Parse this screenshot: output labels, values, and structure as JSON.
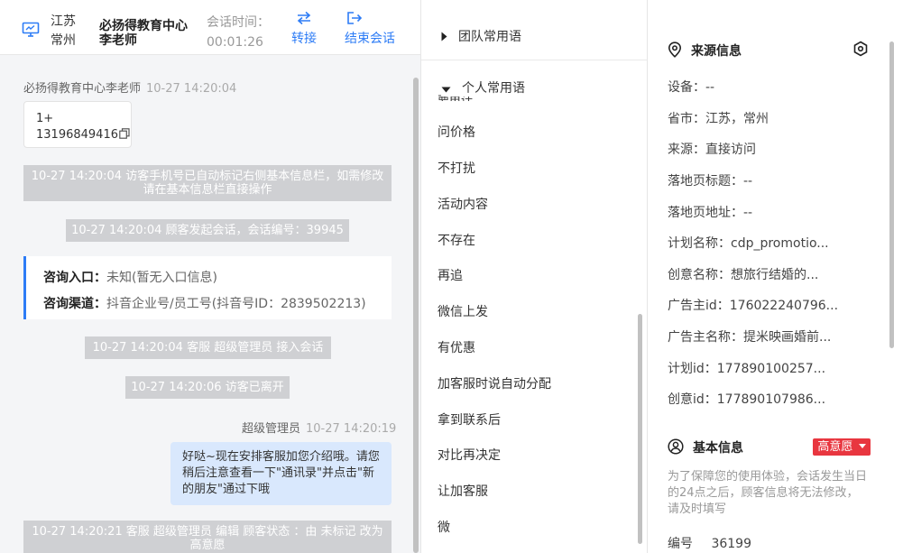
{
  "header": {
    "region_province": "江苏",
    "region_city": "常州",
    "agent_name": "必扬得教育中心李老师",
    "timer_label": "会话时间：",
    "timer_value": "00:01:26",
    "transfer_label": "转接",
    "end_label": "结束会话"
  },
  "chat": {
    "msg1_sender": "必扬得教育中心李老师",
    "msg1_time": "10-27 14:20:04",
    "phone_line1": "1+",
    "phone_line2": "13196849416",
    "sys1": "10-27 14:20:04 访客手机号已自动标记右侧基本信息栏，如需修改请在基本信息栏直接操作",
    "sys2": "10-27 14:20:04 顾客发起会话，会话编号：39945",
    "entry_label": "咨询入口：",
    "entry_value": "未知(暂无入口信息)",
    "channel_label": "咨询渠道：",
    "channel_value": "抖音企业号/员工号(抖音号ID：2839502213)",
    "sys3": "10-27 14:20:04 客服 超级管理员 接入会话",
    "sys4": "10-27 14:20:06 访客已离开",
    "msg2_sender": "超级管理员",
    "msg2_time": "10-27 14:20:19",
    "msg2_text": "好哒~现在安排客服加您介绍哦。请您稍后注意查看一下\"通讯录\"并点击\"新的朋友\"通过下哦",
    "sys5": "10-27 14:20:21 客服 超级管理员 编辑 顾客状态 ：由 未标记 改为 高意愿"
  },
  "phrases": {
    "team_label": "团队常用语",
    "personal_label": "个人常用语",
    "partial_item": "要电话",
    "items": [
      "问价格",
      "不打扰",
      "活动内容",
      "不存在",
      "再追",
      "微信上发",
      "有优惠",
      "加客服时说自动分配",
      "拿到联系后",
      "对比再决定",
      "让加客服",
      "微"
    ]
  },
  "source": {
    "title": "来源信息",
    "fields": [
      "设备：--",
      "省市：江苏，常州",
      "来源：直接访问",
      "落地页标题：--",
      "落地页地址：--",
      "计划名称：cdp_promotio...",
      "创意名称：想旅行结婚的...",
      "广告主id：176022240796...",
      "广告主名称：提米映画婚前...",
      "计划id：177890100257...",
      "创意id：177890107986..."
    ]
  },
  "basic": {
    "title": "基本信息",
    "intent_badge": "高意愿",
    "notice": "为了保障您的使用体验，会话发生当日的24点之后，顾客信息将无法修改，请及时填写",
    "id_label": "编号",
    "id_value": "36199"
  },
  "colors": {
    "accent": "#2d7cf6",
    "badge": "#e8363f",
    "bubble": "#d9e8fd",
    "system_msg": "#cfd0d3"
  }
}
